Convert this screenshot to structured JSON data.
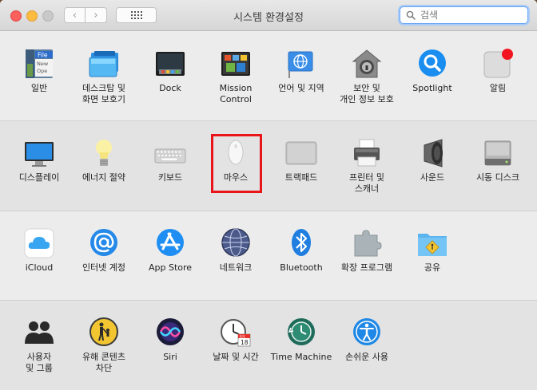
{
  "window": {
    "title": "시스템 환경설정",
    "search_placeholder": "검색",
    "nav_back": "‹",
    "nav_forward": "›"
  },
  "rows": [
    [
      {
        "id": "general",
        "label": "일반",
        "icon": "general-icon"
      },
      {
        "id": "desktop",
        "label": "데스크탑 및\n화면 보호기",
        "icon": "desktop-screensaver-icon"
      },
      {
        "id": "dock",
        "label": "Dock",
        "icon": "dock-icon"
      },
      {
        "id": "mission",
        "label": "Mission\nControl",
        "icon": "mission-control-icon"
      },
      {
        "id": "language",
        "label": "언어 및 지역",
        "icon": "globe-flag-icon"
      },
      {
        "id": "security",
        "label": "보안 및\n개인 정보 보호",
        "icon": "house-lock-icon"
      },
      {
        "id": "spotlight",
        "label": "Spotlight",
        "icon": "spotlight-icon"
      },
      {
        "id": "notifications",
        "label": "알림",
        "icon": "notifications-icon"
      }
    ],
    [
      {
        "id": "displays",
        "label": "디스플레이",
        "icon": "display-icon"
      },
      {
        "id": "energy",
        "label": "에너지 절약",
        "icon": "lightbulb-icon"
      },
      {
        "id": "keyboard",
        "label": "키보드",
        "icon": "keyboard-icon"
      },
      {
        "id": "mouse",
        "label": "마우스",
        "icon": "mouse-icon"
      },
      {
        "id": "trackpad",
        "label": "트랙패드",
        "icon": "trackpad-icon"
      },
      {
        "id": "printers",
        "label": "프린터 및\n스캐너",
        "icon": "printer-icon"
      },
      {
        "id": "sound",
        "label": "사운드",
        "icon": "speaker-icon"
      },
      {
        "id": "startup",
        "label": "시동 디스크",
        "icon": "hard-disk-icon"
      }
    ],
    [
      {
        "id": "icloud",
        "label": "iCloud",
        "icon": "icloud-icon"
      },
      {
        "id": "internet",
        "label": "인터넷 계정",
        "icon": "at-sign-icon"
      },
      {
        "id": "appstore",
        "label": "App Store",
        "icon": "app-store-icon"
      },
      {
        "id": "network",
        "label": "네트워크",
        "icon": "network-globe-icon"
      },
      {
        "id": "bluetooth",
        "label": "Bluetooth",
        "icon": "bluetooth-icon"
      },
      {
        "id": "extensions",
        "label": "확장 프로그램",
        "icon": "puzzle-icon"
      },
      {
        "id": "sharing",
        "label": "공유",
        "icon": "sharing-folder-icon"
      }
    ],
    [
      {
        "id": "users",
        "label": "사용자\n및 그룹",
        "icon": "users-icon"
      },
      {
        "id": "parental",
        "label": "유해 콘텐츠\n차단",
        "icon": "parental-controls-icon"
      },
      {
        "id": "siri",
        "label": "Siri",
        "icon": "siri-icon"
      },
      {
        "id": "datetime",
        "label": "날짜 및 시간",
        "icon": "clock-calendar-icon"
      },
      {
        "id": "timemachine",
        "label": "Time Machine",
        "icon": "time-machine-icon"
      },
      {
        "id": "accessibility",
        "label": "손쉬운 사용",
        "icon": "accessibility-icon"
      }
    ]
  ],
  "icon_text": {
    "general_file": "File",
    "general_new": "New",
    "general_open": "Ope",
    "calendar_month": "JUL",
    "calendar_day": "18"
  },
  "colors": {
    "highlight": "#e8151b",
    "search_focus": "#6aa5f5"
  }
}
